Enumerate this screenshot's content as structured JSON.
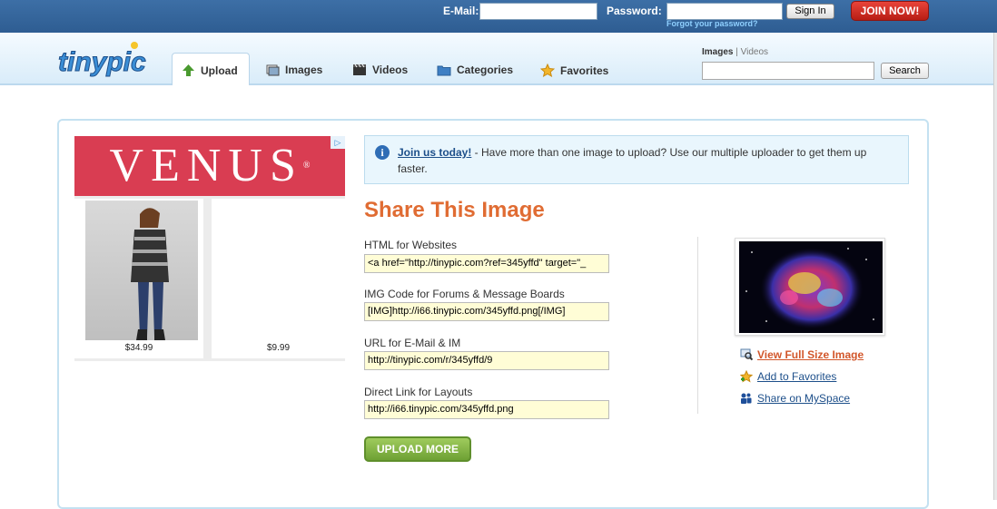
{
  "login": {
    "email_label": "E-Mail:",
    "password_label": "Password:",
    "signin_label": "Sign In",
    "forgot_label": "Forgot your password?",
    "join_label": "JOIN NOW!"
  },
  "logo": {
    "text": "tinypic"
  },
  "nav": {
    "tabs": [
      {
        "label": "Upload",
        "icon": "up-arrow-icon"
      },
      {
        "label": "Images",
        "icon": "images-icon"
      },
      {
        "label": "Videos",
        "icon": "film-icon"
      },
      {
        "label": "Categories",
        "icon": "folder-icon"
      },
      {
        "label": "Favorites",
        "icon": "star-icon"
      }
    ],
    "search_scope_images": "Images",
    "search_scope_sep": "|",
    "search_scope_videos": "Videos",
    "search_button": "Search"
  },
  "ad": {
    "brand": "VENUS",
    "prices": [
      "$34.99",
      "$9.99"
    ]
  },
  "info": {
    "link": "Join us today!",
    "text": " - Have more than one image to upload? Use our multiple uploader to get them up faster."
  },
  "share": {
    "title": "Share This Image",
    "fields": [
      {
        "label": "HTML for Websites",
        "value": "<a href=\"http://tinypic.com?ref=345yffd\" target=\"_"
      },
      {
        "label": "IMG Code for Forums & Message Boards",
        "value": "[IMG]http://i66.tinypic.com/345yffd.png[/IMG]"
      },
      {
        "label": "URL for E-Mail & IM",
        "value": "http://tinypic.com/r/345yffd/9"
      },
      {
        "label": "Direct Link for Layouts",
        "value": "http://i66.tinypic.com/345yffd.png"
      }
    ],
    "upload_more": "UPLOAD MORE"
  },
  "links": [
    {
      "label": "View Full Size Image",
      "icon": "magnifier-icon"
    },
    {
      "label": "Add to Favorites",
      "icon": "star-add-icon"
    },
    {
      "label": "Share on MySpace",
      "icon": "myspace-icon"
    }
  ],
  "colors": {
    "topbar": "#2e5d92",
    "accent_orange": "#e06c33",
    "join_red": "#c9271c",
    "upload_green": "#7fb33f",
    "link_blue": "#1d4f8a"
  }
}
